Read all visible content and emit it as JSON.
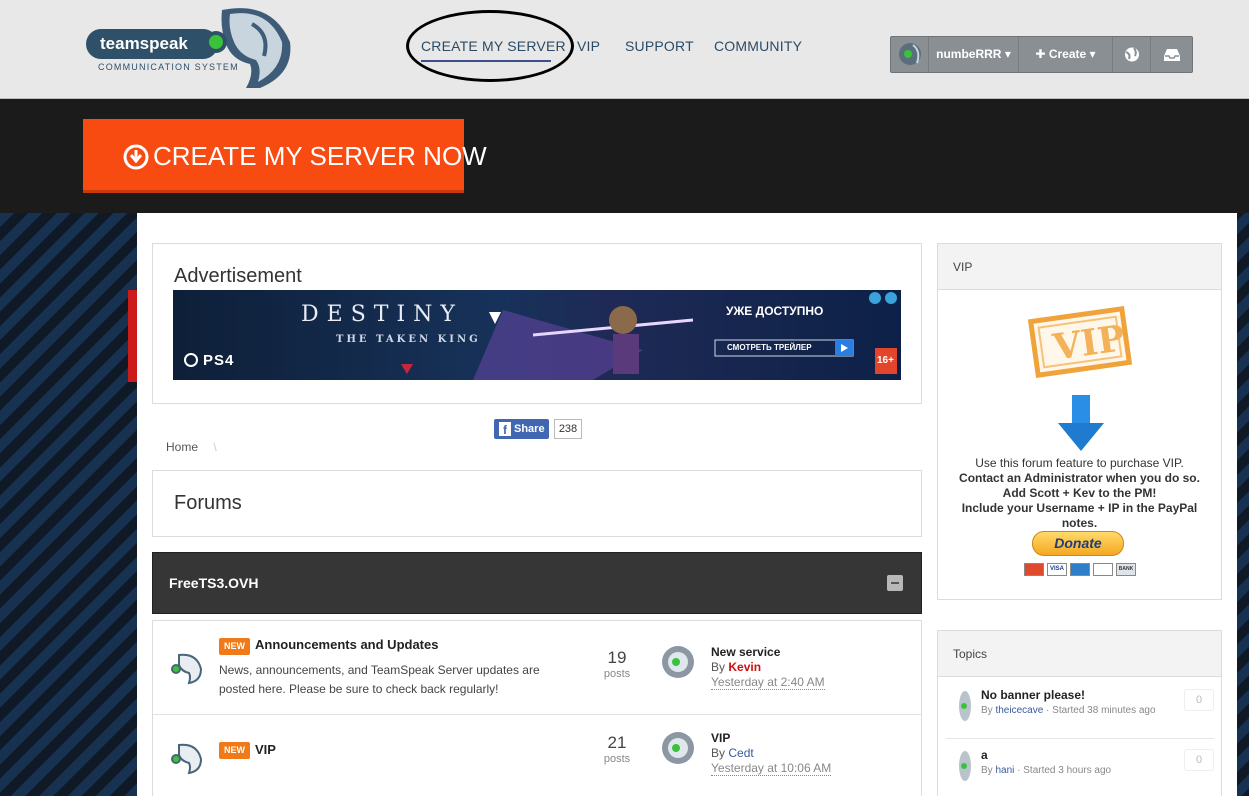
{
  "header": {
    "logo_text": "teamspeak",
    "logo_subtext": "COMMUNICATION SYSTEM",
    "nav": [
      {
        "label": "CREATE MY SERVER"
      },
      {
        "label": "VIP"
      },
      {
        "label": "SUPPORT"
      },
      {
        "label": "COMMUNITY"
      }
    ],
    "userbar": {
      "username": "numbeRRR",
      "create_label": "Create"
    }
  },
  "banner": {
    "cta_label": "CREATE MY SERVER NOW"
  },
  "advertisement": {
    "title": "Advertisement",
    "game": "DESTINY",
    "subtitle": "THE TAKEN KING",
    "platform": "PS4",
    "available_text": "УЖЕ ДОСТУПНО",
    "trailer_button": "СМОТРЕТЬ ТРЕЙЛЕР",
    "rating": "16+"
  },
  "share": {
    "label": "Share",
    "count": "238"
  },
  "breadcrumb": {
    "home": "Home"
  },
  "forums": {
    "title": "Forums",
    "category": "FreeTS3.OVH",
    "items": [
      {
        "badge": "NEW",
        "title": "Announcements and Updates",
        "description": "News, announcements, and TeamSpeak Server updates are posted here. Please be sure to check back regularly!",
        "post_count": "19",
        "posts_label": "posts",
        "last_title": "New service",
        "last_by_prefix": "By",
        "last_by": "Kevin",
        "last_time": "Yesterday at 2:40 AM"
      },
      {
        "badge": "NEW",
        "title": "VIP",
        "description": "",
        "post_count": "21",
        "posts_label": "posts",
        "last_title": "VIP",
        "last_by_prefix": "By",
        "last_by": "Cedt",
        "last_time": "Yesterday at 10:06 AM"
      }
    ]
  },
  "sidebar": {
    "vip": {
      "title": "VIP",
      "stamp_text": "VIP",
      "line1": "Use this forum feature to purchase VIP.",
      "line2": "Contact an Administrator when you do so.",
      "line3": "Add Scott + Kev to the PM!",
      "line4": "Include your Username + IP in the PayPal notes.",
      "donate_label": "Donate",
      "card_labels": [
        "VISA",
        "BANK"
      ]
    },
    "topics": {
      "title": "Topics",
      "items": [
        {
          "title": "No banner please!",
          "by_prefix": "By",
          "author": "theicecave",
          "started": "· Started 38 minutes ago",
          "replies": "0"
        },
        {
          "title": "a",
          "by_prefix": "By",
          "author": "hani",
          "started": "· Started 3 hours ago",
          "replies": "0"
        }
      ]
    }
  },
  "colors": {
    "cta": "#f74b12",
    "nav_text": "#2c4a63",
    "header_bg": "#e8e8e8",
    "category_bg": "#363636",
    "badge_new": "#f07a1a",
    "admin_red": "#cc1111"
  }
}
